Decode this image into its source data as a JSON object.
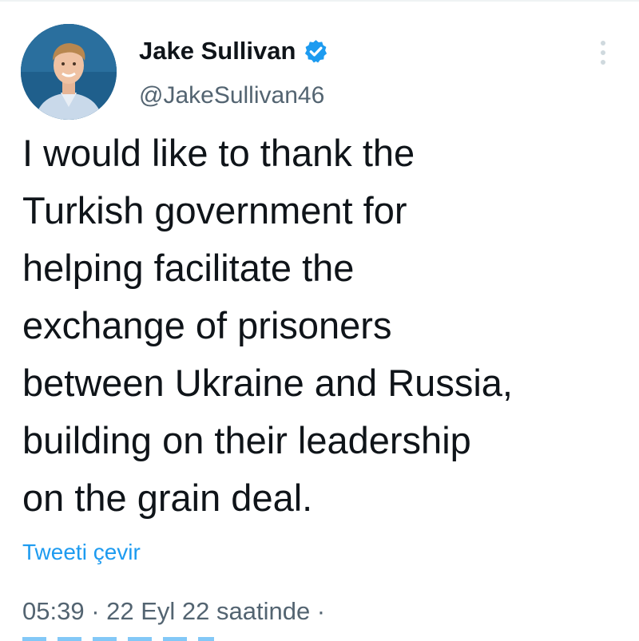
{
  "author": {
    "display_name": "Jake Sullivan",
    "handle": "@JakeSullivan46",
    "verified": true,
    "avatar_icon": "profile-photo"
  },
  "tweet": {
    "lines": [
      "I would like to thank the",
      "Turkish government for",
      "helping facilitate the",
      "exchange of prisoners",
      "between Ukraine and Russia,",
      "building on their leadership",
      "on the grain deal."
    ],
    "translate_label": "Tweeti çevir",
    "timestamp": "05:39 · 22 Eyl 22 saatinde ·"
  },
  "colors": {
    "link": "#1d9bf0",
    "secondary_text": "#536471",
    "primary_text": "#0f1419",
    "verified_badge": "#1d9bf0"
  },
  "icons": {
    "more": "more-vertical-icon",
    "verified": "verified-badge-icon"
  }
}
